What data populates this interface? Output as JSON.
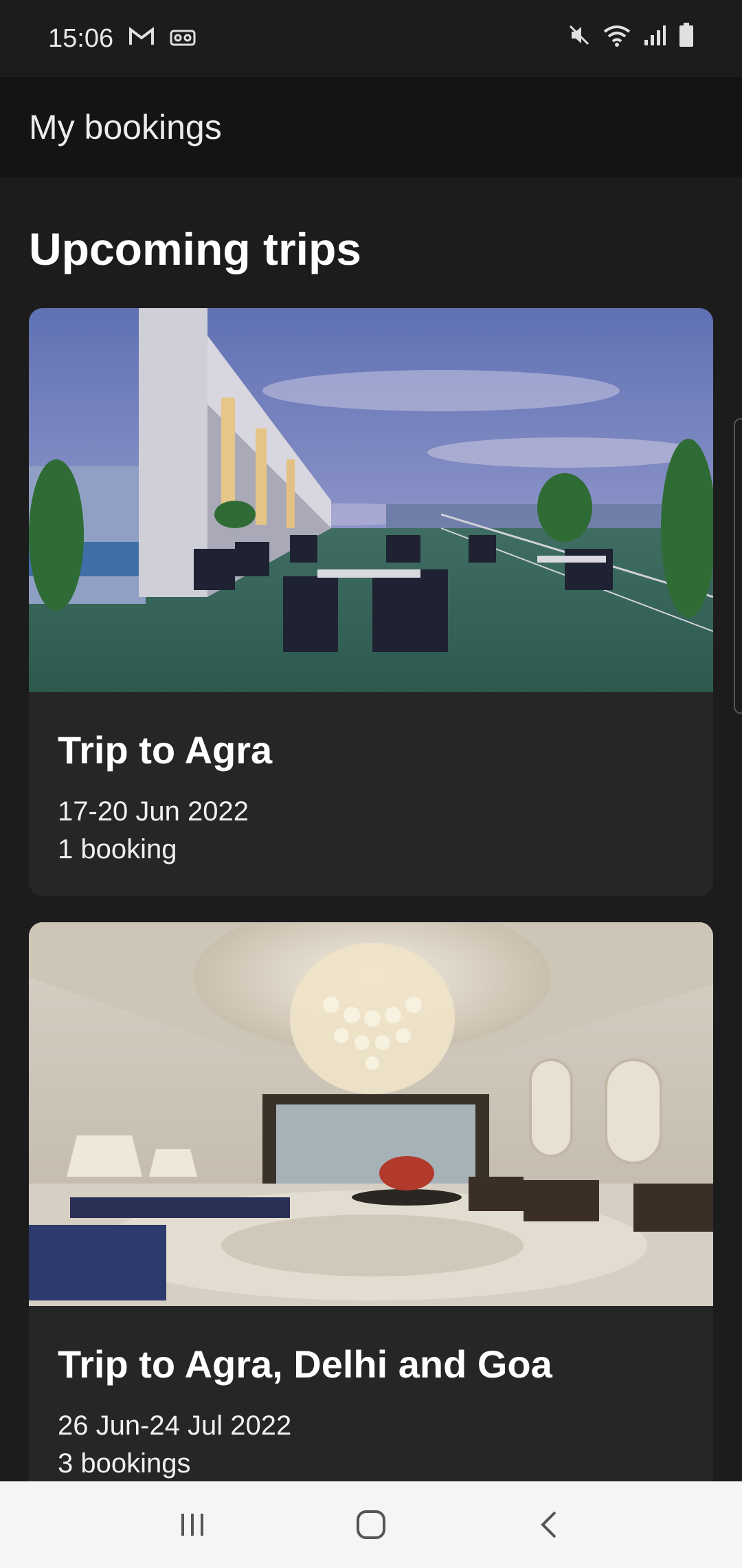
{
  "status_bar": {
    "time": "15:06",
    "left_icons": [
      "gmail-icon",
      "voicemail-icon"
    ],
    "right_icons": [
      "mute-icon",
      "wifi-icon",
      "signal-icon",
      "battery-icon"
    ]
  },
  "app_bar": {
    "title": "My bookings"
  },
  "section": {
    "title": "Upcoming trips"
  },
  "trips": [
    {
      "title": "Trip to Agra",
      "dates": "17-20 Jun 2022",
      "bookings": "1 booking",
      "image": "rooftop-terrace-image"
    },
    {
      "title": "Trip to Agra, Delhi and Goa",
      "dates": "26 Jun-24 Jul 2022",
      "bookings": "3 bookings",
      "image": "hotel-lobby-image"
    }
  ],
  "nav_bar": {
    "icons": [
      "recent-apps-icon",
      "home-icon",
      "back-icon"
    ]
  },
  "colors": {
    "background": "#1c1c1d",
    "card": "#262627",
    "app_bar": "#141414",
    "nav_bar": "#f5f5f5"
  }
}
